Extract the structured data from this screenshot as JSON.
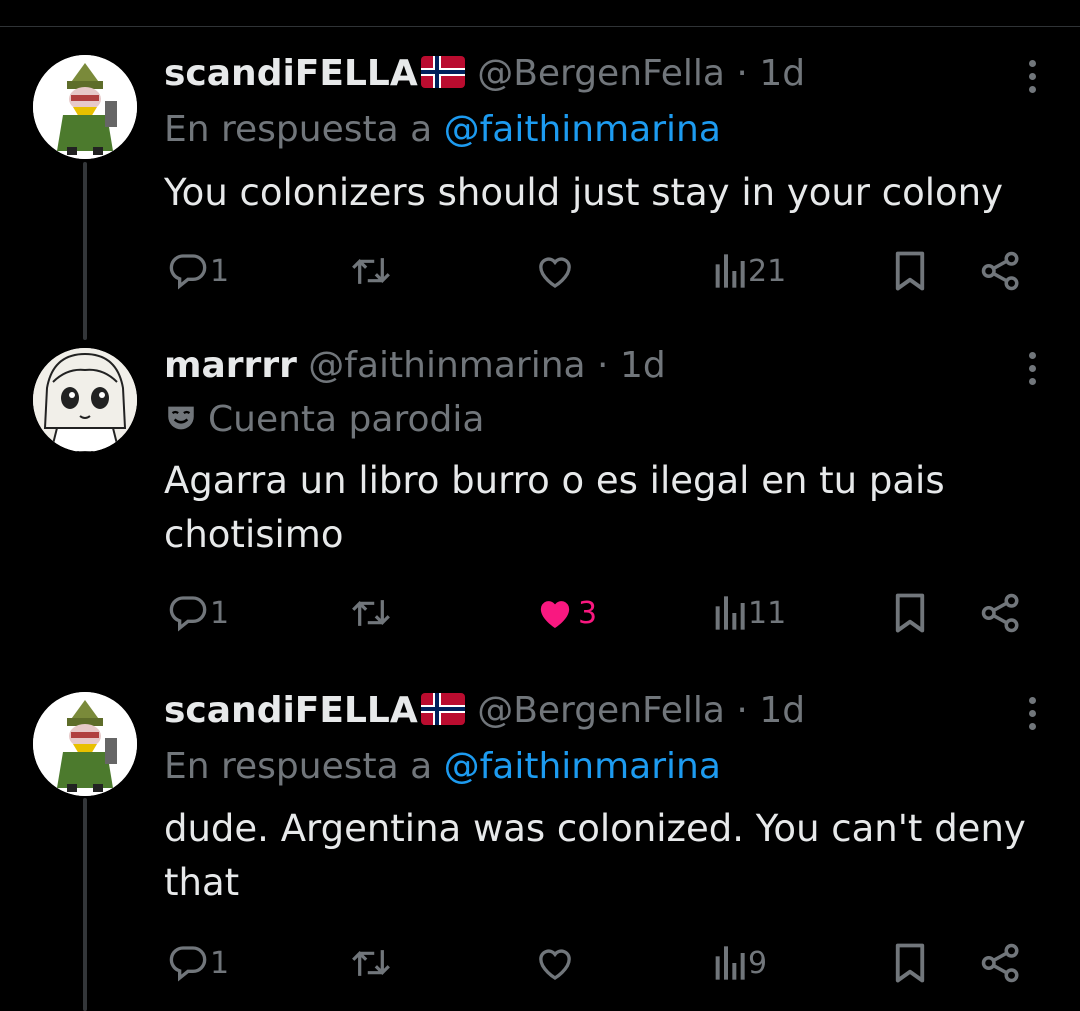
{
  "tweets": [
    {
      "name": "scandiFELLA",
      "handle": "@BergenFella",
      "dot": "·",
      "time": "1d",
      "subtitle_prefix": "En respuesta a ",
      "subtitle_mention": "@faithinmarina",
      "text": "You colonizers should just stay in your colony",
      "replies": "1",
      "likes": "",
      "views": "21",
      "liked": false
    },
    {
      "name": "marrrr",
      "handle": "@faithinmarina",
      "dot": "·",
      "time": "1d",
      "subtitle_label": "Cuenta parodia",
      "text": "Agarra un libro burro o es ilegal en tu pais chotisimo",
      "replies": "1",
      "likes": "3",
      "views": "11",
      "liked": true
    },
    {
      "name": "scandiFELLA",
      "handle": "@BergenFella",
      "dot": "·",
      "time": "1d",
      "subtitle_prefix": "En respuesta a ",
      "subtitle_mention": "@faithinmarina",
      "text": "dude. Argentina was colonized. You can't deny that",
      "replies": "1",
      "likes": "",
      "views": "9",
      "liked": false
    }
  ],
  "icons": {
    "reply": "reply-icon",
    "retweet": "retweet-icon",
    "like": "heart-icon",
    "views": "views-icon",
    "bookmark": "bookmark-icon",
    "share": "share-icon",
    "flag": "norway-flag-icon",
    "parody": "parody-mask-icon"
  },
  "colors": {
    "background": "#000000",
    "text": "#e7e9ea",
    "muted": "#71767b",
    "link": "#1d9bf0",
    "like": "#f91880"
  }
}
